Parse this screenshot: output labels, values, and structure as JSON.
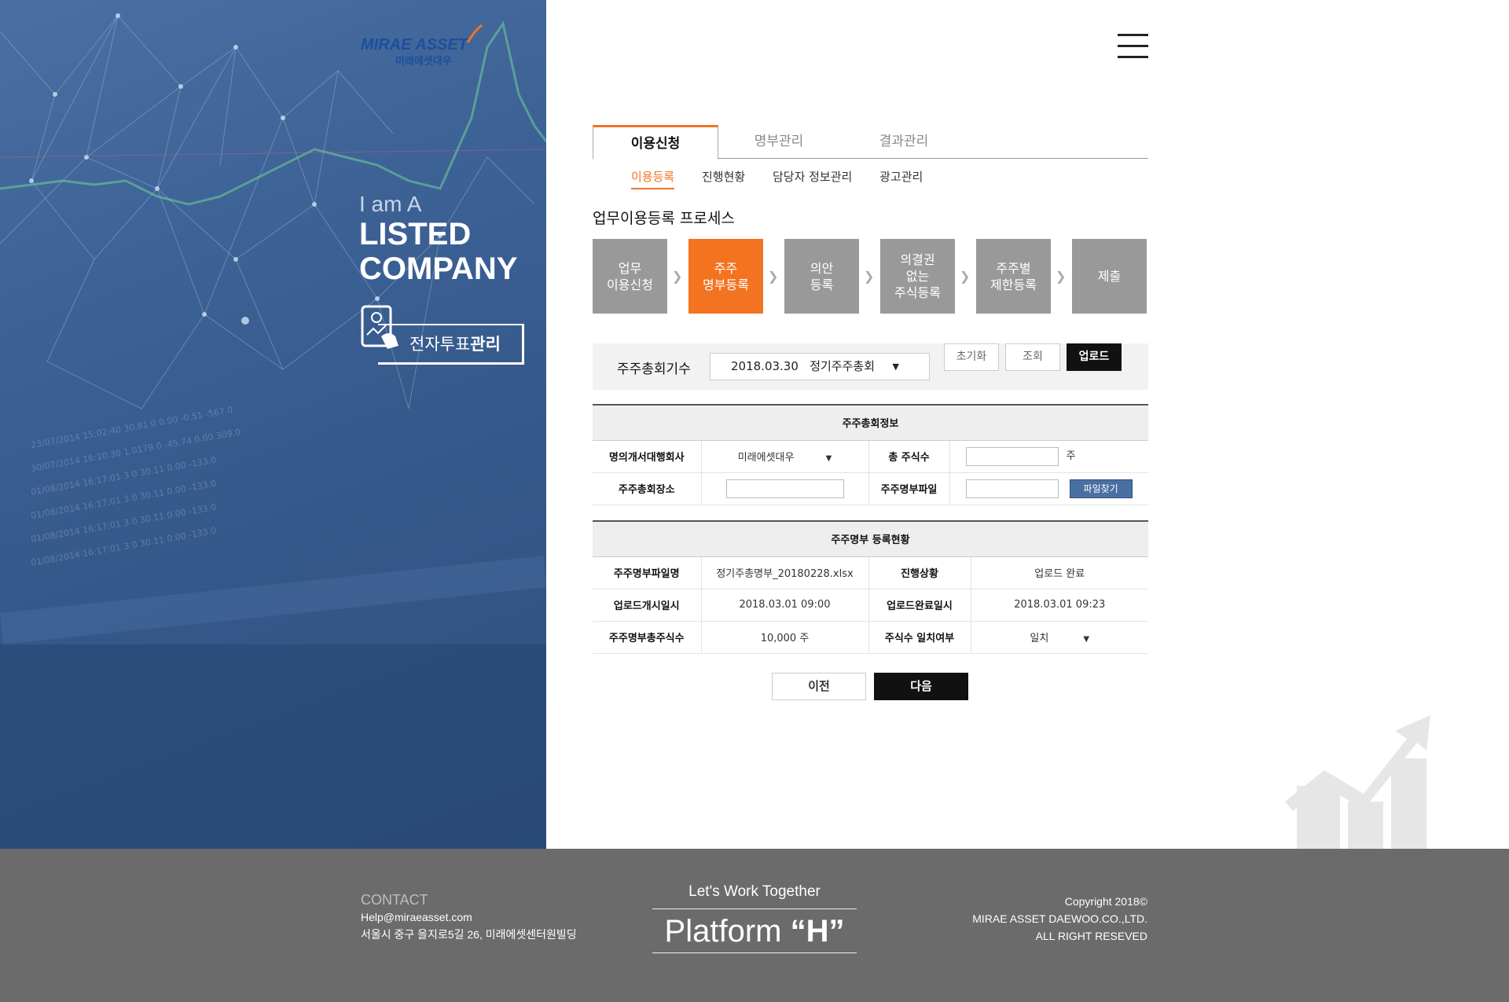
{
  "brand": {
    "name_en": "MIRAE ASSET",
    "name_ko": "미래에셋대우"
  },
  "hero": {
    "line1": "I am A",
    "line2": "LISTED",
    "line3": "COMPANY",
    "evote_prefix": "전자투표",
    "evote_bold": "관리"
  },
  "tabs": [
    {
      "label": "이용신청",
      "active": true
    },
    {
      "label": "명부관리",
      "active": false
    },
    {
      "label": "결과관리",
      "active": false
    }
  ],
  "subtabs": [
    {
      "label": "이용등록",
      "active": true
    },
    {
      "label": "진행현황",
      "active": false
    },
    {
      "label": "담당자 정보관리",
      "active": false
    },
    {
      "label": "광고관리",
      "active": false
    }
  ],
  "process": {
    "title": "업무이용등록 프로세스",
    "steps": [
      {
        "label": "업무\n이용신청",
        "active": false
      },
      {
        "label": "주주\n명부등록",
        "active": true
      },
      {
        "label": "의안\n등록",
        "active": false
      },
      {
        "label": "의결권\n없는\n주식등록",
        "active": false
      },
      {
        "label": "주주별\n제한등록",
        "active": false
      },
      {
        "label": "제출",
        "active": false
      }
    ]
  },
  "filter": {
    "label": "주주총회기수",
    "select_value": "2018.03.30   정기주주총회",
    "reset": "초기화",
    "search": "조회",
    "upload": "업로드"
  },
  "meeting_info": {
    "title": "주주총회정보",
    "agent_label": "명의개서대행회사",
    "agent_value": "미래에셋대우",
    "total_shares_label": "총 주식수",
    "shares_unit": "주",
    "place_label": "주주총회장소",
    "file_label": "주주명부파일",
    "file_button": "파일찾기"
  },
  "register_status": {
    "title": "주주명부 등록현황",
    "file_name_label": "주주명부파일명",
    "file_name_value": "정기주총명부_20180228.xlsx",
    "status_label": "진행상황",
    "status_value": "업로드 완료",
    "upload_start_label": "업로드개시일시",
    "upload_start_value": "2018.03.01 09:00",
    "upload_end_label": "업로드완료일시",
    "upload_end_value": "2018.03.01 09:23",
    "total_label": "주주명부총주식수",
    "total_value": "10,000 주",
    "match_label": "주식수 일치여부",
    "match_value": "일치"
  },
  "nav": {
    "prev": "이전",
    "next": "다음"
  },
  "footer": {
    "contact_title": "CONTACT",
    "email": "Help@miraeasset.com",
    "address": "서울시 중구 을지로5길 26, 미래에셋센터원빌딩",
    "slogan": "Let's Work Together",
    "platform_prefix": "Platform ",
    "platform_bold": "“H”",
    "copyright": "Copyright 2018©",
    "company": "MIRAE ASSET DAEWOO.CO.,LTD.",
    "rights": "ALL RIGHT RESEVED"
  },
  "colors": {
    "accent": "#f37321",
    "step_inactive": "#999999",
    "footer": "#6b6b6b",
    "file_button": "#4a6fa3"
  }
}
